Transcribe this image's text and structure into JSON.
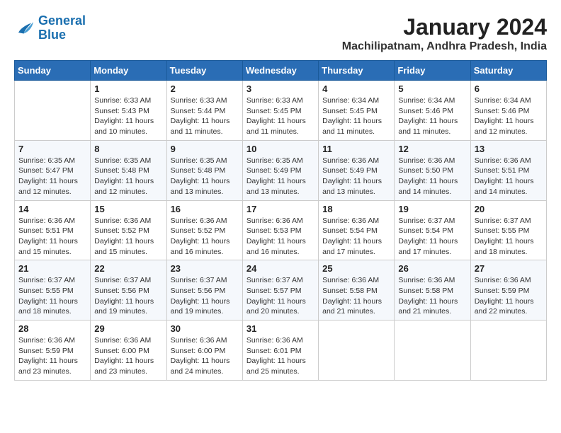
{
  "logo": {
    "line1": "General",
    "line2": "Blue"
  },
  "title": "January 2024",
  "subtitle": "Machilipatnam, Andhra Pradesh, India",
  "headers": [
    "Sunday",
    "Monday",
    "Tuesday",
    "Wednesday",
    "Thursday",
    "Friday",
    "Saturday"
  ],
  "weeks": [
    [
      {
        "day": "",
        "info": ""
      },
      {
        "day": "1",
        "info": "Sunrise: 6:33 AM\nSunset: 5:43 PM\nDaylight: 11 hours and 10 minutes."
      },
      {
        "day": "2",
        "info": "Sunrise: 6:33 AM\nSunset: 5:44 PM\nDaylight: 11 hours and 11 minutes."
      },
      {
        "day": "3",
        "info": "Sunrise: 6:33 AM\nSunset: 5:45 PM\nDaylight: 11 hours and 11 minutes."
      },
      {
        "day": "4",
        "info": "Sunrise: 6:34 AM\nSunset: 5:45 PM\nDaylight: 11 hours and 11 minutes."
      },
      {
        "day": "5",
        "info": "Sunrise: 6:34 AM\nSunset: 5:46 PM\nDaylight: 11 hours and 11 minutes."
      },
      {
        "day": "6",
        "info": "Sunrise: 6:34 AM\nSunset: 5:46 PM\nDaylight: 11 hours and 12 minutes."
      }
    ],
    [
      {
        "day": "7",
        "info": "Sunrise: 6:35 AM\nSunset: 5:47 PM\nDaylight: 11 hours and 12 minutes."
      },
      {
        "day": "8",
        "info": "Sunrise: 6:35 AM\nSunset: 5:48 PM\nDaylight: 11 hours and 12 minutes."
      },
      {
        "day": "9",
        "info": "Sunrise: 6:35 AM\nSunset: 5:48 PM\nDaylight: 11 hours and 13 minutes."
      },
      {
        "day": "10",
        "info": "Sunrise: 6:35 AM\nSunset: 5:49 PM\nDaylight: 11 hours and 13 minutes."
      },
      {
        "day": "11",
        "info": "Sunrise: 6:36 AM\nSunset: 5:49 PM\nDaylight: 11 hours and 13 minutes."
      },
      {
        "day": "12",
        "info": "Sunrise: 6:36 AM\nSunset: 5:50 PM\nDaylight: 11 hours and 14 minutes."
      },
      {
        "day": "13",
        "info": "Sunrise: 6:36 AM\nSunset: 5:51 PM\nDaylight: 11 hours and 14 minutes."
      }
    ],
    [
      {
        "day": "14",
        "info": "Sunrise: 6:36 AM\nSunset: 5:51 PM\nDaylight: 11 hours and 15 minutes."
      },
      {
        "day": "15",
        "info": "Sunrise: 6:36 AM\nSunset: 5:52 PM\nDaylight: 11 hours and 15 minutes."
      },
      {
        "day": "16",
        "info": "Sunrise: 6:36 AM\nSunset: 5:52 PM\nDaylight: 11 hours and 16 minutes."
      },
      {
        "day": "17",
        "info": "Sunrise: 6:36 AM\nSunset: 5:53 PM\nDaylight: 11 hours and 16 minutes."
      },
      {
        "day": "18",
        "info": "Sunrise: 6:36 AM\nSunset: 5:54 PM\nDaylight: 11 hours and 17 minutes."
      },
      {
        "day": "19",
        "info": "Sunrise: 6:37 AM\nSunset: 5:54 PM\nDaylight: 11 hours and 17 minutes."
      },
      {
        "day": "20",
        "info": "Sunrise: 6:37 AM\nSunset: 5:55 PM\nDaylight: 11 hours and 18 minutes."
      }
    ],
    [
      {
        "day": "21",
        "info": "Sunrise: 6:37 AM\nSunset: 5:55 PM\nDaylight: 11 hours and 18 minutes."
      },
      {
        "day": "22",
        "info": "Sunrise: 6:37 AM\nSunset: 5:56 PM\nDaylight: 11 hours and 19 minutes."
      },
      {
        "day": "23",
        "info": "Sunrise: 6:37 AM\nSunset: 5:56 PM\nDaylight: 11 hours and 19 minutes."
      },
      {
        "day": "24",
        "info": "Sunrise: 6:37 AM\nSunset: 5:57 PM\nDaylight: 11 hours and 20 minutes."
      },
      {
        "day": "25",
        "info": "Sunrise: 6:36 AM\nSunset: 5:58 PM\nDaylight: 11 hours and 21 minutes."
      },
      {
        "day": "26",
        "info": "Sunrise: 6:36 AM\nSunset: 5:58 PM\nDaylight: 11 hours and 21 minutes."
      },
      {
        "day": "27",
        "info": "Sunrise: 6:36 AM\nSunset: 5:59 PM\nDaylight: 11 hours and 22 minutes."
      }
    ],
    [
      {
        "day": "28",
        "info": "Sunrise: 6:36 AM\nSunset: 5:59 PM\nDaylight: 11 hours and 23 minutes."
      },
      {
        "day": "29",
        "info": "Sunrise: 6:36 AM\nSunset: 6:00 PM\nDaylight: 11 hours and 23 minutes."
      },
      {
        "day": "30",
        "info": "Sunrise: 6:36 AM\nSunset: 6:00 PM\nDaylight: 11 hours and 24 minutes."
      },
      {
        "day": "31",
        "info": "Sunrise: 6:36 AM\nSunset: 6:01 PM\nDaylight: 11 hours and 25 minutes."
      },
      {
        "day": "",
        "info": ""
      },
      {
        "day": "",
        "info": ""
      },
      {
        "day": "",
        "info": ""
      }
    ]
  ]
}
